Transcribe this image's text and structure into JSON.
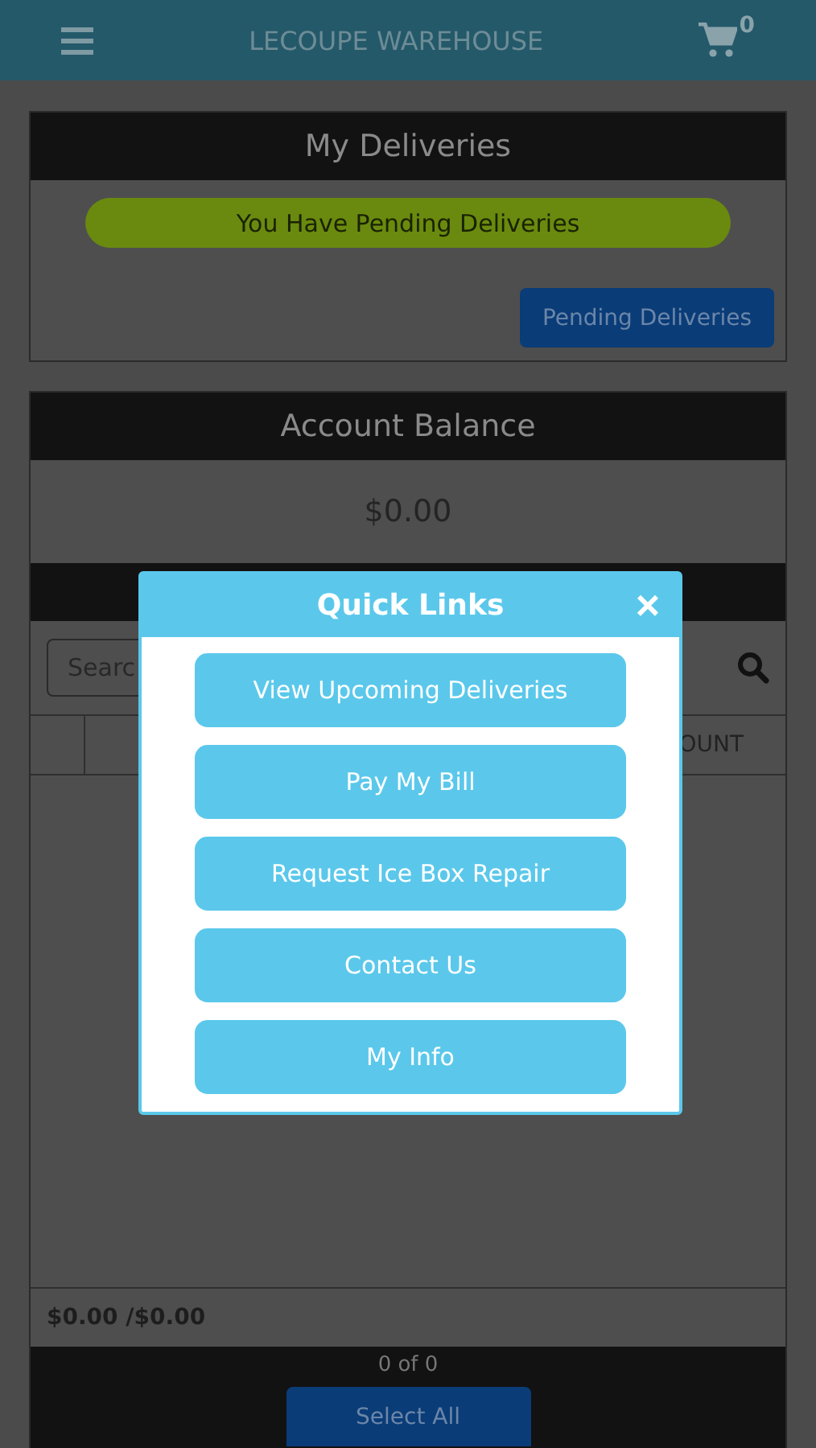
{
  "header": {
    "title": "LECOUPE WAREHOUSE",
    "cart_count": "0"
  },
  "deliveries": {
    "title": "My Deliveries",
    "notice": "You Have Pending Deliveries",
    "button": "Pending Deliveries"
  },
  "balance": {
    "title": "Account Balance",
    "amount": "$0.00"
  },
  "orders": {
    "search": {
      "placeholder": "Searc"
    },
    "column_3": "OUNT",
    "totals": "$0.00 /$0.00",
    "pager": "0 of 0",
    "button": "Select All"
  },
  "modal": {
    "title": "Quick Links",
    "close": "×",
    "links": [
      "View Upcoming Deliveries",
      "Pay My Bill",
      "Request Ice Box Repair",
      "Contact Us",
      "My Info"
    ]
  }
}
